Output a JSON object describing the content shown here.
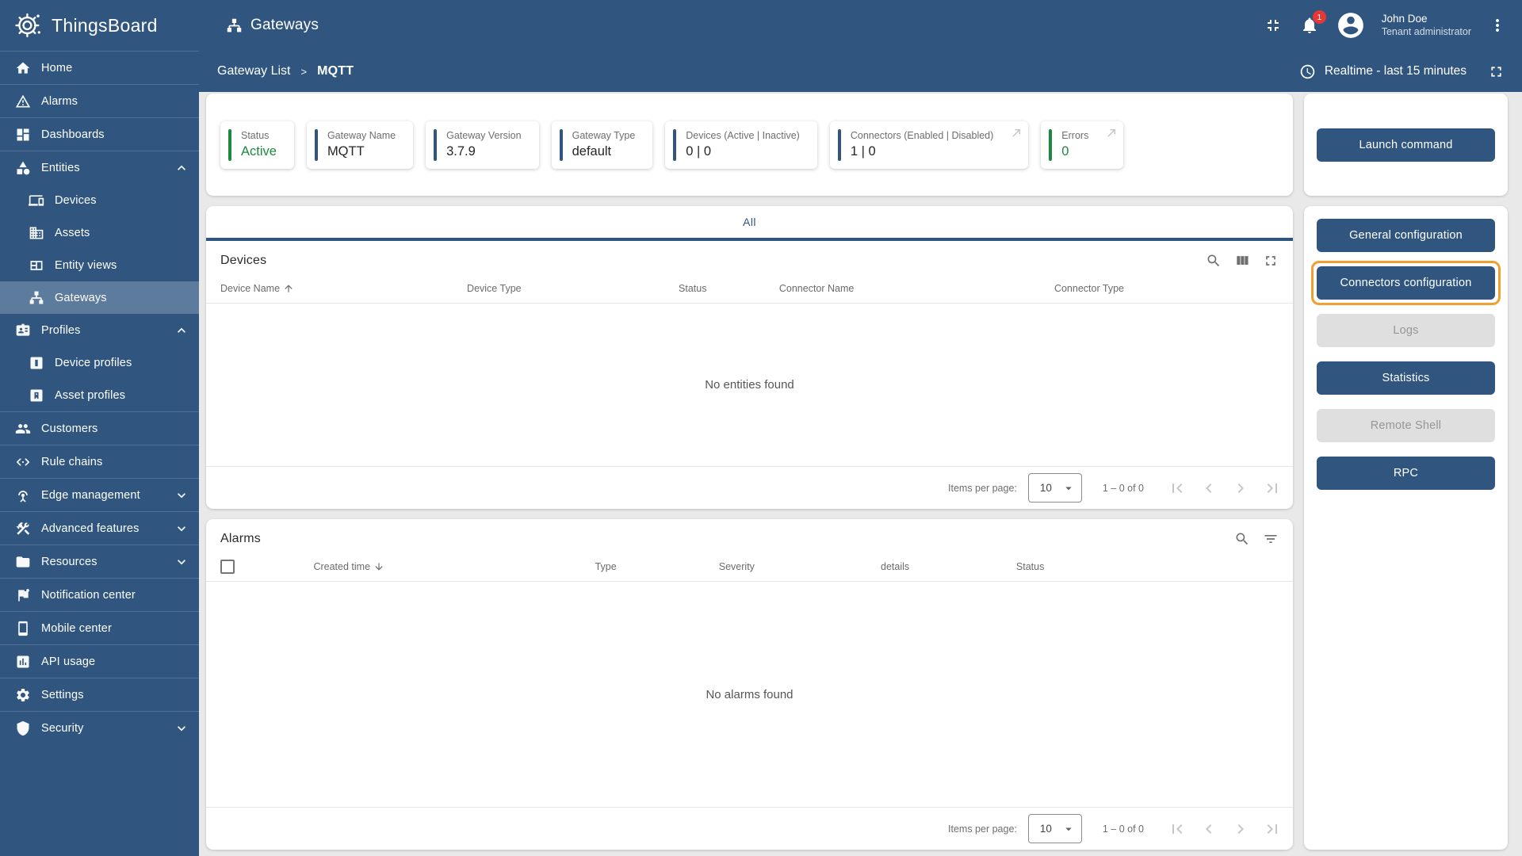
{
  "colors": {
    "primary": "#305680",
    "sidebar_selected": "rgba(255,255,255,0.22)",
    "status_green": "#1b8a3e",
    "highlight_orange": "#f0a030",
    "badge_red": "#e53935",
    "disabled_bg": "#dfdfdf",
    "disabled_text": "#969696",
    "page_bg": "#e9e9e9"
  },
  "brand": {
    "name": "ThingsBoard",
    "logo_icon": "thingsboard-gear-logo"
  },
  "topbar": {
    "title": "Gateways",
    "title_icon": "lan-icon",
    "collapse_icon": "collapse-icon",
    "notifications": {
      "icon": "bell-icon",
      "badge": "1"
    },
    "user": {
      "name": "John Doe",
      "role": "Tenant administrator",
      "avatar_icon": "account-circle-icon"
    },
    "menu_icon": "more-vert-icon"
  },
  "breadcrumb": {
    "parent": "Gateway List",
    "separator": ">",
    "current": "MQTT"
  },
  "timewindow": {
    "icon": "clock-icon",
    "label": "Realtime - last 15 minutes",
    "fullscreen_icon": "fullscreen-icon"
  },
  "sidebar": {
    "items": [
      {
        "label": "Home",
        "icon": "home-icon"
      },
      {
        "label": "Alarms",
        "icon": "warning-icon"
      },
      {
        "label": "Dashboards",
        "icon": "dashboards-icon"
      },
      {
        "label": "Entities",
        "icon": "category-icon",
        "expanded": true
      },
      {
        "label": "Devices",
        "icon": "devices-icon",
        "sub": true
      },
      {
        "label": "Assets",
        "icon": "building-icon",
        "sub": true
      },
      {
        "label": "Entity views",
        "icon": "view-quilt-icon",
        "sub": true
      },
      {
        "label": "Gateways",
        "icon": "lan-icon",
        "sub": true,
        "selected": true
      },
      {
        "label": "Profiles",
        "icon": "badge-icon",
        "expanded": true
      },
      {
        "label": "Device profiles",
        "icon": "device-profile-icon",
        "sub": true
      },
      {
        "label": "Asset profiles",
        "icon": "asset-profile-icon",
        "sub": true
      },
      {
        "label": "Customers",
        "icon": "people-icon"
      },
      {
        "label": "Rule chains",
        "icon": "rule-chain-icon"
      },
      {
        "label": "Edge management",
        "icon": "antenna-icon",
        "collapsed": true
      },
      {
        "label": "Advanced features",
        "icon": "tools-icon",
        "collapsed": true
      },
      {
        "label": "Resources",
        "icon": "folder-icon",
        "collapsed": true
      },
      {
        "label": "Notification center",
        "icon": "flag-icon"
      },
      {
        "label": "Mobile center",
        "icon": "smartphone-icon"
      },
      {
        "label": "API usage",
        "icon": "bar-chart-icon"
      },
      {
        "label": "Settings",
        "icon": "gear-icon"
      },
      {
        "label": "Security",
        "icon": "shield-icon",
        "collapsed": true
      }
    ]
  },
  "stats": {
    "cards": [
      {
        "label": "Status",
        "value": "Active",
        "accent": "green",
        "link_arrow": false
      },
      {
        "label": "Gateway Name",
        "value": "MQTT",
        "accent": "blue",
        "link_arrow": false
      },
      {
        "label": "Gateway Version",
        "value": "3.7.9",
        "accent": "blue",
        "link_arrow": false
      },
      {
        "label": "Gateway Type",
        "value": "default",
        "accent": "blue",
        "link_arrow": false
      },
      {
        "label": "Devices (Active | Inactive)",
        "value": "0 | 0",
        "accent": "blue",
        "link_arrow": false
      },
      {
        "label": "Connectors (Enabled | Disabled)",
        "value": "1 | 0",
        "accent": "blue",
        "link_arrow": true
      },
      {
        "label": "Errors",
        "value": "0",
        "accent": "green",
        "link_arrow": true
      }
    ]
  },
  "tabs": {
    "all": "All"
  },
  "devices_panel": {
    "title": "Devices",
    "icons": [
      "search-icon",
      "view-columns-icon",
      "fullscreen-icon"
    ],
    "columns": [
      "Device Name",
      "Device Type",
      "Status",
      "Connector Name",
      "Connector Type"
    ],
    "sort": {
      "column": "Device Name",
      "direction": "asc"
    },
    "empty": "No entities found"
  },
  "alarms_panel": {
    "title": "Alarms",
    "icons": [
      "search-icon",
      "filter-icon"
    ],
    "columns": [
      "Created time",
      "Type",
      "Severity",
      "details",
      "Status"
    ],
    "sort": {
      "column": "Created time",
      "direction": "desc"
    },
    "empty": "No alarms found"
  },
  "pagination": {
    "items_per_page_label": "Items per page:",
    "page_size": "10",
    "range": "1 – 0 of 0"
  },
  "actions": {
    "launch": "Launch command",
    "general": "General configuration",
    "connectors": "Connectors configuration",
    "logs": "Logs",
    "statistics": "Statistics",
    "remote_shell": "Remote Shell",
    "rpc": "RPC"
  }
}
